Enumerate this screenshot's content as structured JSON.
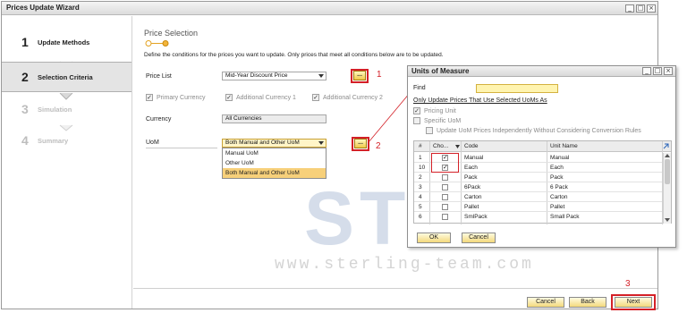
{
  "window": {
    "title": "Prices Update Wizard",
    "controls": [
      "_",
      "□",
      "×"
    ]
  },
  "steps": [
    {
      "num": "1",
      "label": "Update Methods",
      "state": "done"
    },
    {
      "num": "2",
      "label": "Selection Criteria",
      "state": "active"
    },
    {
      "num": "3",
      "label": "Simulation",
      "state": "disabled"
    },
    {
      "num": "4",
      "label": "Summary",
      "state": "disabled"
    }
  ],
  "content": {
    "heading": "Price Selection",
    "description": "Define the conditions for the prices you want to update. Only prices that meet all conditions below are to be updated.",
    "price_list_label": "Price List",
    "price_list_value": "Mid-Year Discount Price",
    "primary_currency": "Primary Currency",
    "additional_currency_1": "Additional Currency 1",
    "additional_currency_2": "Additional Currency 2",
    "currency_label": "Currency",
    "currency_value": "All Currencies",
    "uom_label": "UoM",
    "uom_value": "Both Manual and Other UoM",
    "uom_options": [
      "Manual UoM",
      "Other UoM",
      "Both Manual and Other UoM"
    ],
    "ellipsis": "..."
  },
  "annotations": {
    "one": "1",
    "two": "2",
    "three": "3"
  },
  "watermark": {
    "text": "STEM",
    "url": "www.sterling-team.com"
  },
  "footer": {
    "cancel": "Cancel",
    "back": "Back",
    "next": "Next"
  },
  "uom_dialog": {
    "title": "Units of Measure",
    "find_label": "Find",
    "only_update": "Only Update Prices That Use Selected UoMs As",
    "pricing_unit": "Pricing Unit",
    "specific_uom": "Specific UoM",
    "update_independently": "Update UoM Prices Independently Without Considering Conversion Rules",
    "columns": [
      "#",
      "Cho...",
      "Code",
      "Unit Name"
    ],
    "rows": [
      {
        "num": "1",
        "checked": true,
        "code": "Manual",
        "name": "Manual"
      },
      {
        "num": "10",
        "checked": true,
        "code": "Each",
        "name": "Each"
      },
      {
        "num": "2",
        "checked": false,
        "code": "Pack",
        "name": "Pack"
      },
      {
        "num": "3",
        "checked": false,
        "code": "6Pack",
        "name": "6 Pack"
      },
      {
        "num": "4",
        "checked": false,
        "code": "Carton",
        "name": "Carton"
      },
      {
        "num": "5",
        "checked": false,
        "code": "Pallet",
        "name": "Pallet"
      },
      {
        "num": "6",
        "checked": false,
        "code": "SmlPack",
        "name": "Small Pack"
      }
    ],
    "ok": "OK",
    "cancel": "Cancel"
  }
}
